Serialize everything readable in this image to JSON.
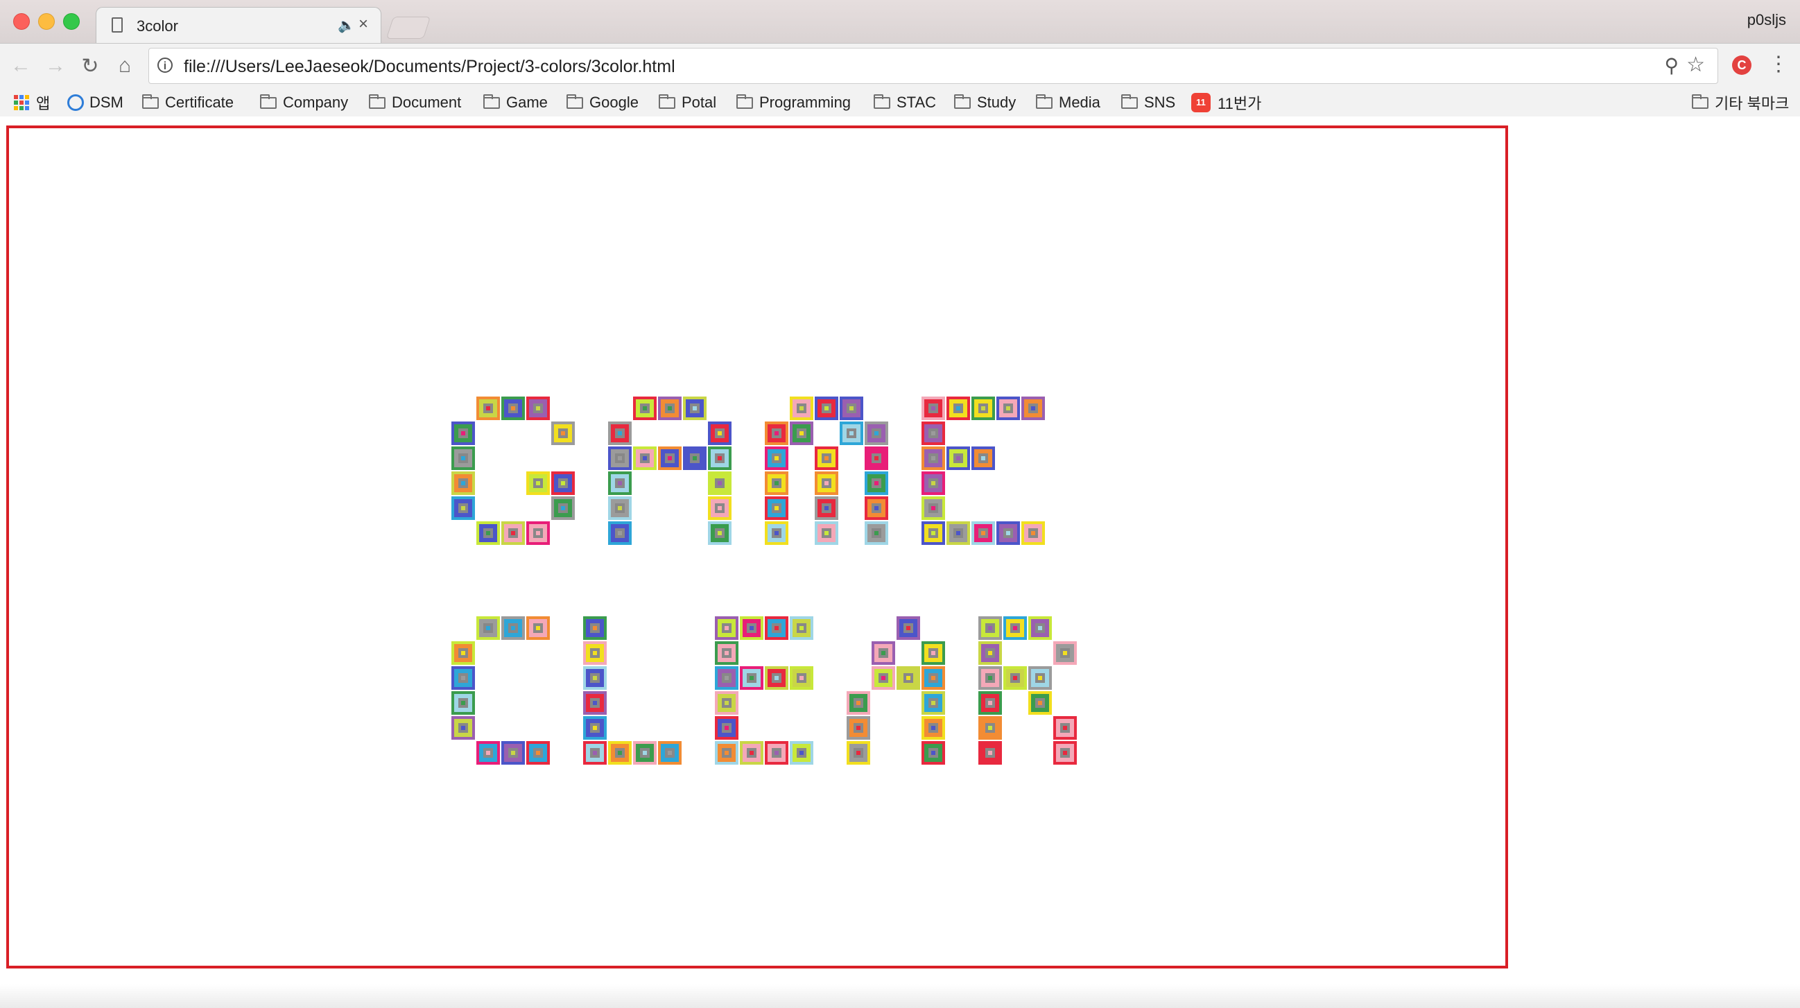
{
  "tab": {
    "title": "3color"
  },
  "profile": "p0sljs",
  "address_bar": {
    "url": "file:///Users/LeeJaeseok/Documents/Project/3-colors/3color.html"
  },
  "bookmarks": {
    "apps": "앱",
    "items": [
      "DSM",
      "Certificate",
      "Company",
      "Document",
      "Game",
      "Google",
      "Potal",
      "Programming",
      "STAC",
      "Study",
      "Media",
      "SNS",
      "11번가"
    ],
    "other": "기타 북마크"
  },
  "game": {
    "text_rows": [
      "GAME",
      "CLEAR"
    ],
    "palette": [
      "#f2df1f",
      "#e8293f",
      "#2ea6d8",
      "#3b9c4e",
      "#f4a8b8",
      "#4c55c9",
      "#f28c34",
      "#c9d646",
      "#9b9b9b",
      "#9fd6e6",
      "#e81e78",
      "#9a5fb0",
      "#c8e83a"
    ]
  }
}
